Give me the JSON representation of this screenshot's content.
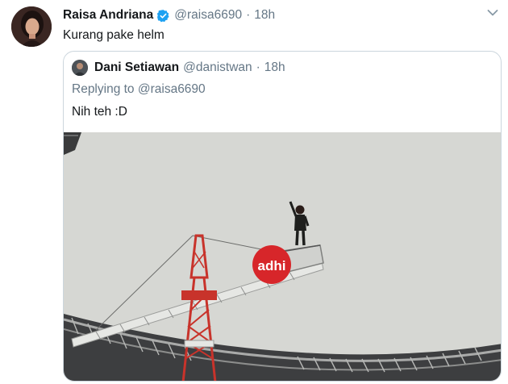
{
  "tweet": {
    "author_name": "Raisa Andriana",
    "author_handle": "@raisa6690",
    "separator": "·",
    "time": "18h",
    "text": "Kurang pake helm",
    "verified": true,
    "avatar_icon": "user-avatar-photo",
    "menu_icon": "chevron-down-icon"
  },
  "quote": {
    "author_name": "Dani Setiawan",
    "author_handle": "@danistwan",
    "separator": "·",
    "time": "18h",
    "replying_prefix": "Replying to",
    "replying_handle": "@raisa6690",
    "text": "Nih teh :D",
    "photo": {
      "sign_text": "adhi"
    }
  },
  "colors": {
    "text_primary": "#14171a",
    "text_secondary": "#657786",
    "verified_blue": "#1da1f2",
    "border": "#ccd6dd",
    "sky": "#d8d9d6",
    "crane_red": "#c8332b",
    "sign_red": "#d7262a"
  }
}
